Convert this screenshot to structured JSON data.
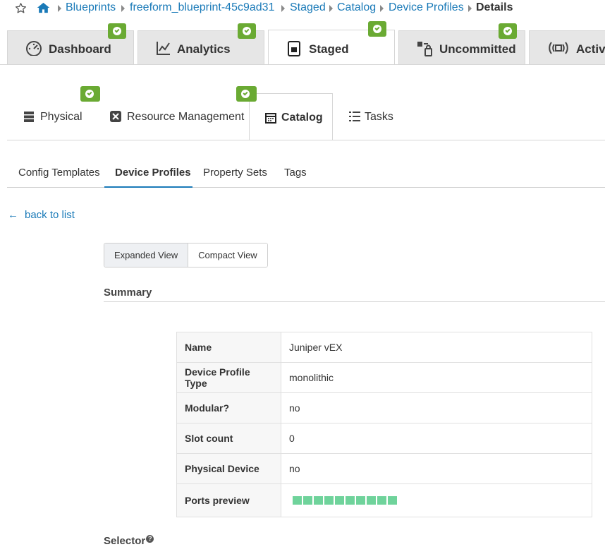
{
  "breadcrumb": {
    "items": [
      "Blueprints",
      "freeform_blueprint-45c9ad31",
      "Staged",
      "Catalog",
      "Device Profiles"
    ],
    "current": "Details"
  },
  "top_tabs": [
    {
      "label": "Dashboard",
      "icon": "gauge-icon",
      "badge": "check"
    },
    {
      "label": "Analytics",
      "icon": "line-chart-icon",
      "badge": "check"
    },
    {
      "label": "Staged",
      "icon": "staged-doc-icon",
      "badge": "check",
      "active": true
    },
    {
      "label": "Uncommitted",
      "icon": "uncommitted-icon",
      "badge": "check"
    },
    {
      "label": "Active",
      "icon": "broadcast-icon"
    }
  ],
  "sub_tabs": [
    {
      "label": "Physical",
      "icon": "server-stack-icon",
      "badge": "check"
    },
    {
      "label": "Resource Management",
      "icon": "resource-icon",
      "badge": "check"
    },
    {
      "label": "Catalog",
      "icon": "catalog-icon",
      "active": true
    },
    {
      "label": "Tasks",
      "icon": "list-icon"
    }
  ],
  "tertiary_tabs": [
    {
      "label": "Config Templates"
    },
    {
      "label": "Device Profiles",
      "active": true
    },
    {
      "label": "Property Sets"
    },
    {
      "label": "Tags"
    }
  ],
  "back_link": "back to list",
  "view_toggle": {
    "expanded": "Expanded View",
    "compact": "Compact View",
    "selected": "Expanded View"
  },
  "summary": {
    "title": "Summary",
    "rows": [
      {
        "key": "Name",
        "value": "Juniper vEX"
      },
      {
        "key": "Device Profile Type",
        "value": "monolithic"
      },
      {
        "key": "Modular?",
        "value": "no"
      },
      {
        "key": "Slot count",
        "value": "0"
      },
      {
        "key": "Physical Device",
        "value": "no"
      },
      {
        "key": "Ports preview",
        "value": ""
      }
    ],
    "ports_preview_count": 10
  },
  "selector": {
    "title": "Selector"
  },
  "colors": {
    "link": "#1a7ab8",
    "badge": "#6aaa33",
    "port": "#6fd39b"
  }
}
